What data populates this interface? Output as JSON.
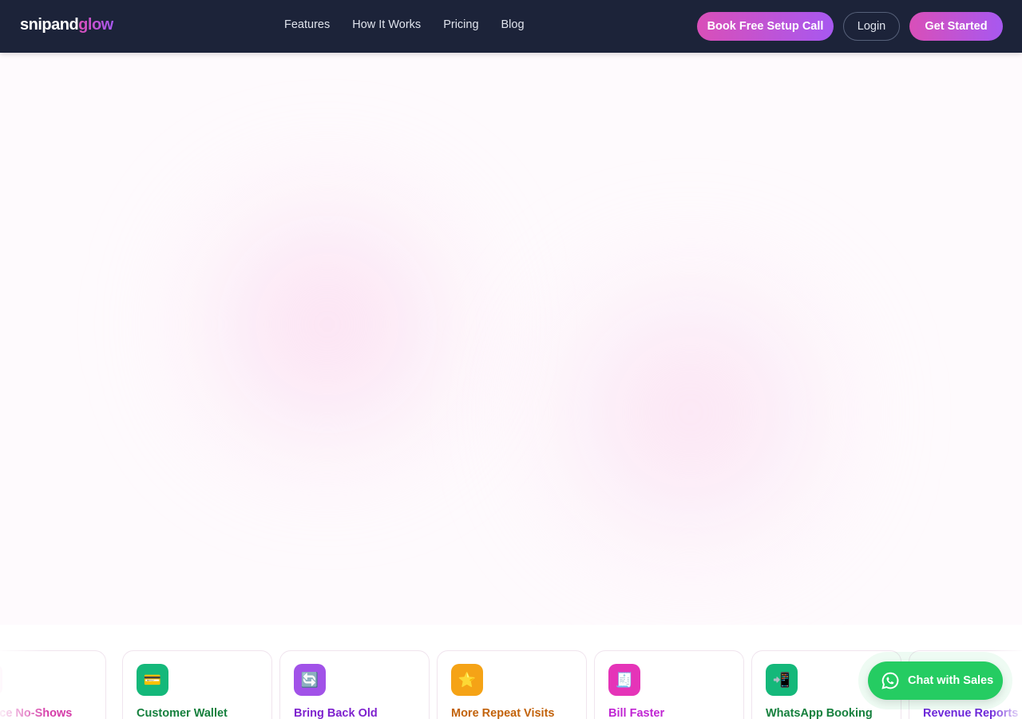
{
  "header": {
    "logo_part1": "snipand",
    "logo_part2": "glow",
    "nav": [
      "Features",
      "How It Works",
      "Pricing",
      "Blog"
    ],
    "setup_button": "Book Free Setup Call",
    "login_button": "Login",
    "start_button": "Get Started"
  },
  "colors": {
    "header_bg": "#1c2339",
    "accent_pink": "#d94fb8",
    "accent_purple": "#a758f0",
    "whatsapp_green": "#25cc62"
  },
  "cards": [
    {
      "label": "Reduce No-Shows",
      "icon": "calendar-icon",
      "glyph": "",
      "color": "#d53ca8",
      "bg": "#f7c7e6"
    },
    {
      "label": "Customer Wallet",
      "icon": "credit-card-icon",
      "glyph": "💳",
      "color": "#15803d",
      "bg": "#14b87a"
    },
    {
      "label": "Bring Back Old",
      "icon": "refresh-icon",
      "glyph": "🔄",
      "color": "#7e22ce",
      "bg": "#a152e8"
    },
    {
      "label": "More Repeat Visits",
      "icon": "star-icon",
      "glyph": "⭐",
      "color": "#c2620a",
      "bg": "#f5a316"
    },
    {
      "label": "Bill Faster",
      "icon": "receipt-icon",
      "glyph": "🧾",
      "color": "#c026d3",
      "bg": "#e534b8"
    },
    {
      "label": "WhatsApp Booking",
      "icon": "mobile-icon",
      "glyph": "📲",
      "color": "#15803d",
      "bg": "#14b87a"
    },
    {
      "label": "Revenue Reports",
      "icon": "chart-icon",
      "glyph": "",
      "color": "#6d28d9",
      "bg": "#c9b2f5"
    }
  ],
  "chat": {
    "label": "Chat with Sales",
    "icon": "whatsapp-icon"
  }
}
